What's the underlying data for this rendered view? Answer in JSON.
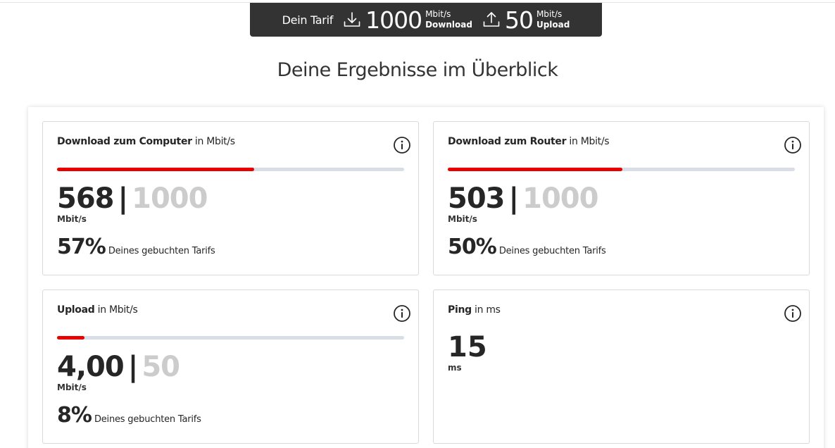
{
  "tariff": {
    "label": "Dein Tarif",
    "download_value": "1000",
    "download_unit": "Mbit/s",
    "download_label": "Download",
    "upload_value": "50",
    "upload_unit": "Mbit/s",
    "upload_label": "Upload"
  },
  "headline": "Deine Ergebnisse im Überblick",
  "cards": {
    "download_computer": {
      "title_bold": "Download zum Computer",
      "title_rest": " in Mbit/s",
      "value": "568",
      "separator": "|",
      "max": "1000",
      "unit": "Mbit/s",
      "percent": "57%",
      "percent_text": "Deines gebuchten Tarifs",
      "progress": 0.568
    },
    "download_router": {
      "title_bold": "Download zum Router",
      "title_rest": " in Mbit/s",
      "value": "503",
      "separator": "|",
      "max": "1000",
      "unit": "Mbit/s",
      "percent": "50%",
      "percent_text": "Deines gebuchten Tarifs",
      "progress": 0.503
    },
    "upload": {
      "title_bold": "Upload",
      "title_rest": " in Mbit/s",
      "value": "4,00",
      "separator": "|",
      "max": "50",
      "unit": "Mbit/s",
      "percent": "8%",
      "percent_text": "Deines gebuchten Tarifs",
      "progress": 0.08
    },
    "ping": {
      "title_bold": "Ping",
      "title_rest": " in ms",
      "value": "15",
      "unit": "ms"
    }
  },
  "colors": {
    "accent": "#e60000",
    "track": "#d9dde6",
    "tariff_bg": "#333333",
    "muted": "#cccccc"
  },
  "icons": {
    "download": "download-icon",
    "upload": "upload-icon",
    "info": "info-icon"
  }
}
